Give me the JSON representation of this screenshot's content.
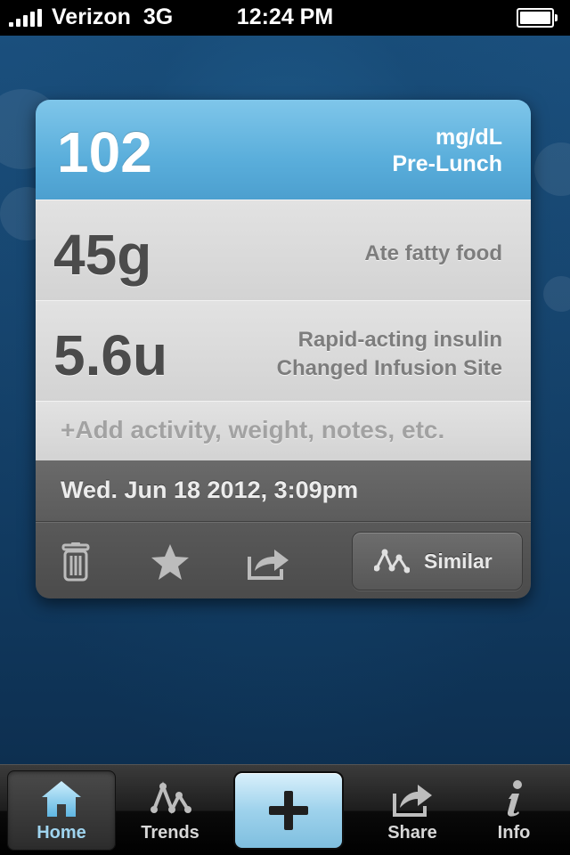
{
  "status_bar": {
    "carrier": "Verizon",
    "network": "3G",
    "time": "12:24 PM"
  },
  "entry": {
    "glucose_value": "102",
    "glucose_unit": "mg/dL",
    "meal_tag": "Pre-Lunch",
    "carbs_value": "45g",
    "carbs_note": "Ate fatty food",
    "insulin_value": "5.6u",
    "insulin_type": "Rapid-acting insulin",
    "insulin_note": "Changed Infusion Site",
    "add_prompt": "+Add activity, weight, notes, etc.",
    "datetime": "Wed. Jun 18 2012, 3:09pm"
  },
  "actions": {
    "similar_label": "Similar",
    "icons": [
      "trash-icon",
      "star-icon",
      "share-arrow-icon",
      "trend-icon"
    ]
  },
  "tab_bar": {
    "tabs": [
      {
        "label": "Home",
        "icon": "home-icon",
        "selected": true
      },
      {
        "label": "Trends",
        "icon": "trends-icon"
      },
      {
        "label": "Share",
        "icon": "share-icon"
      },
      {
        "label": "Info",
        "icon": "info-icon"
      }
    ],
    "add_icon": "plus-icon"
  },
  "colors": {
    "glucose_header": "#5aaedb",
    "selected_tab_label": "#9fd4ef",
    "background": "#174670"
  }
}
